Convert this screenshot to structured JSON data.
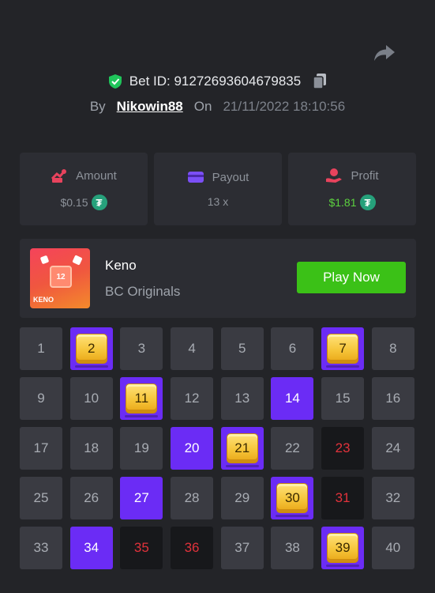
{
  "header": {
    "bet_id_label": "Bet ID: 91272693604679835",
    "by_label": "By",
    "username": "Nikowin88",
    "on_label": "On",
    "datetime": "21/11/2022 18:10:56"
  },
  "stats": {
    "amount_label": "Amount",
    "amount_value": "$0.15",
    "payout_label": "Payout",
    "payout_value": "13 x",
    "profit_label": "Profit",
    "profit_value": "$1.81",
    "currency_glyph": "₮"
  },
  "game": {
    "name": "Keno",
    "provider": "BC Originals",
    "thumb_label": "KENO",
    "thumb_number": "12",
    "play_label": "Play Now"
  },
  "board": {
    "cells": [
      {
        "n": "1",
        "state": "normal"
      },
      {
        "n": "2",
        "state": "hit"
      },
      {
        "n": "3",
        "state": "normal"
      },
      {
        "n": "4",
        "state": "normal"
      },
      {
        "n": "5",
        "state": "normal"
      },
      {
        "n": "6",
        "state": "normal"
      },
      {
        "n": "7",
        "state": "hit"
      },
      {
        "n": "8",
        "state": "normal"
      },
      {
        "n": "9",
        "state": "normal"
      },
      {
        "n": "10",
        "state": "normal"
      },
      {
        "n": "11",
        "state": "hit"
      },
      {
        "n": "12",
        "state": "normal"
      },
      {
        "n": "13",
        "state": "normal"
      },
      {
        "n": "14",
        "state": "picked"
      },
      {
        "n": "15",
        "state": "normal"
      },
      {
        "n": "16",
        "state": "normal"
      },
      {
        "n": "17",
        "state": "normal"
      },
      {
        "n": "18",
        "state": "normal"
      },
      {
        "n": "19",
        "state": "normal"
      },
      {
        "n": "20",
        "state": "picked"
      },
      {
        "n": "21",
        "state": "hit"
      },
      {
        "n": "22",
        "state": "normal"
      },
      {
        "n": "23",
        "state": "miss"
      },
      {
        "n": "24",
        "state": "normal"
      },
      {
        "n": "25",
        "state": "normal"
      },
      {
        "n": "26",
        "state": "normal"
      },
      {
        "n": "27",
        "state": "picked"
      },
      {
        "n": "28",
        "state": "normal"
      },
      {
        "n": "29",
        "state": "normal"
      },
      {
        "n": "30",
        "state": "hit"
      },
      {
        "n": "31",
        "state": "miss"
      },
      {
        "n": "32",
        "state": "normal"
      },
      {
        "n": "33",
        "state": "normal"
      },
      {
        "n": "34",
        "state": "picked"
      },
      {
        "n": "35",
        "state": "miss"
      },
      {
        "n": "36",
        "state": "miss"
      },
      {
        "n": "37",
        "state": "normal"
      },
      {
        "n": "38",
        "state": "normal"
      },
      {
        "n": "39",
        "state": "hit"
      },
      {
        "n": "40",
        "state": "normal"
      }
    ]
  },
  "colors": {
    "accent_purple": "#6b2cf5",
    "play_green": "#3bc117",
    "profit_green": "#5cd13f",
    "miss_red": "#e1323b",
    "gem_gold": "#f6c53a"
  }
}
